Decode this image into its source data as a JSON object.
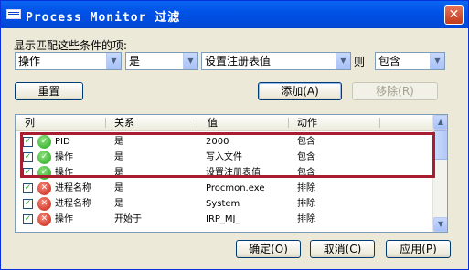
{
  "window": {
    "title": "Process Monitor 过滤",
    "close_glyph": "✕"
  },
  "filter_label": "显示匹配这些条件的项:",
  "criteria": {
    "column": "操作",
    "relation": "是",
    "value": "设置注册表值",
    "then_label": "则",
    "action": "包含"
  },
  "buttons": {
    "reset": "重置",
    "add": "添加(A)",
    "remove": "移除(R)",
    "ok": "确定(O)",
    "cancel": "取消(C)",
    "apply": "应用(P)"
  },
  "table": {
    "headers": {
      "column": "列",
      "relation": "关系",
      "value": "值",
      "action": "动作"
    },
    "rows": [
      {
        "checked": true,
        "status": "ok",
        "column": "PID",
        "relation": "是",
        "value": "2000",
        "action": "包含"
      },
      {
        "checked": true,
        "status": "ok",
        "column": "操作",
        "relation": "是",
        "value": "写入文件",
        "action": "包含"
      },
      {
        "checked": true,
        "status": "ok",
        "column": "操作",
        "relation": "是",
        "value": "设置注册表值",
        "action": "包含"
      },
      {
        "checked": true,
        "status": "no",
        "column": "进程名称",
        "relation": "是",
        "value": "Procmon.exe",
        "action": "排除"
      },
      {
        "checked": true,
        "status": "no",
        "column": "进程名称",
        "relation": "是",
        "value": "System",
        "action": "排除"
      },
      {
        "checked": true,
        "status": "no",
        "column": "操作",
        "relation": "开始于",
        "value": "IRP_MJ_",
        "action": "排除"
      }
    ]
  },
  "colors": {
    "highlight": "#a81d2f",
    "titlebar": "#0052e6"
  }
}
